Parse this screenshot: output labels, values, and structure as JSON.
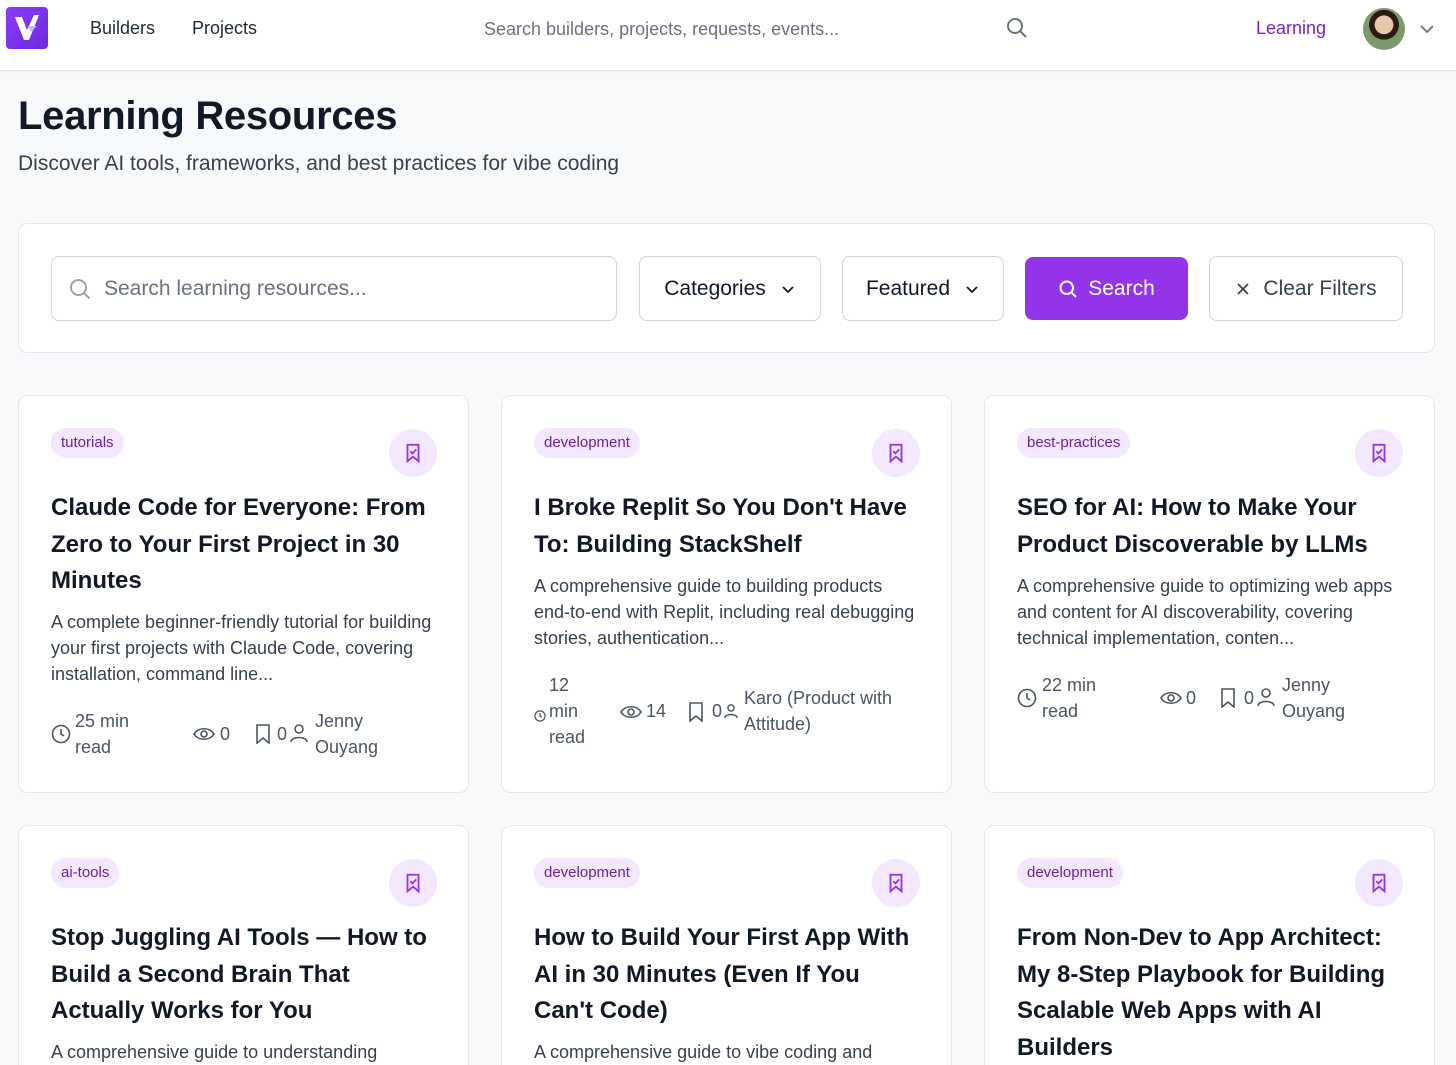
{
  "header": {
    "nav": [
      {
        "label": "Builders"
      },
      {
        "label": "Projects"
      }
    ],
    "search_placeholder": "Search builders, projects, requests, events...",
    "learning_label": "Learning",
    "brand_color": "#9333ea"
  },
  "page": {
    "title": "Learning Resources",
    "subtitle": "Discover AI tools, frameworks, and best practices for vibe coding"
  },
  "filters": {
    "search_placeholder": "Search learning resources...",
    "categories_label": "Categories",
    "featured_label": "Featured",
    "search_button": "Search",
    "clear_button": "Clear Filters"
  },
  "cards": [
    {
      "tag": "tutorials",
      "title": "Claude Code for Everyone: From Zero to Your First Project in 30 Minutes",
      "description": "A complete beginner-friendly tutorial for building your first projects with Claude Code, covering installation, command line...",
      "read_time": "25 min read",
      "views": "0",
      "bookmarks": "0",
      "author": "Jenny Ouyang"
    },
    {
      "tag": "development",
      "title": "I Broke Replit So You Don't Have To: Building StackShelf",
      "description": "A comprehensive guide to building products end-to-end with Replit, including real debugging stories, authentication...",
      "read_time": "12 min read",
      "views": "14",
      "bookmarks": "0",
      "author": "Karo (Product with Attitude)"
    },
    {
      "tag": "best-practices",
      "title": "SEO for AI: How to Make Your Product Discoverable by LLMs",
      "description": "A comprehensive guide to optimizing web apps and content for AI discoverability, covering technical implementation, conten...",
      "read_time": "22 min read",
      "views": "0",
      "bookmarks": "0",
      "author": "Jenny Ouyang"
    },
    {
      "tag": "ai-tools",
      "title": "Stop Juggling AI Tools — How to Build a Second Brain That Actually Works for You",
      "description": "A comprehensive guide to understanding"
    },
    {
      "tag": "development",
      "title": "How to Build Your First App With AI in 30 Minutes (Even If You Can't Code)",
      "description": "A comprehensive guide to vibe coding and"
    },
    {
      "tag": "development",
      "title": "From Non-Dev to App Architect: My 8-Step Playbook for Building Scalable Web Apps with AI Builders",
      "description": ""
    }
  ]
}
